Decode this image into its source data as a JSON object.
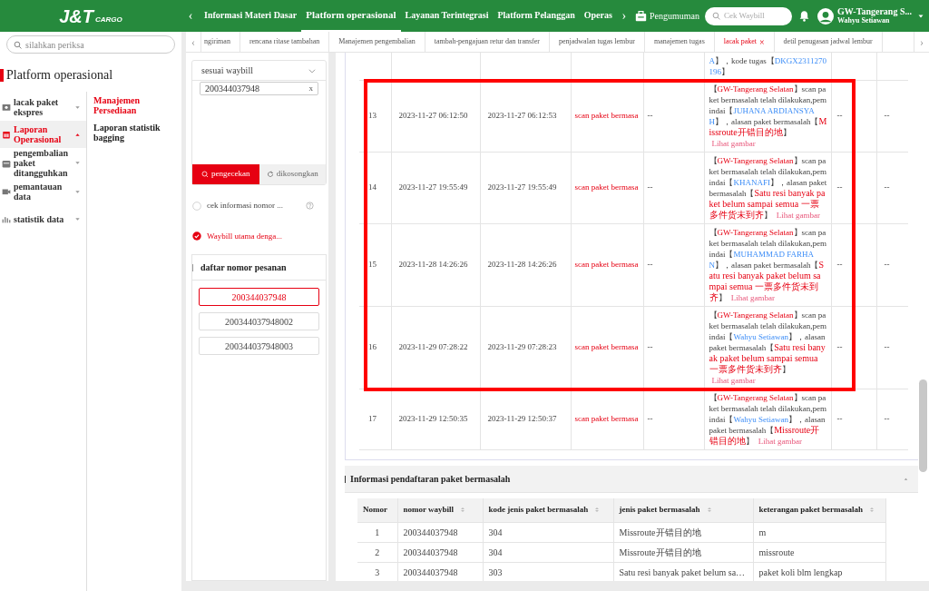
{
  "header": {
    "logo": {
      "main": "J&T",
      "sub": "CARGO"
    },
    "prev": "‹",
    "next": "›",
    "nav": [
      {
        "label": "Informasi Materi Dasar",
        "selected": false
      },
      {
        "label": "Platform operasional",
        "selected": true
      },
      {
        "label": "Layanan Terintegrasi",
        "selected": false
      },
      {
        "label": "Platform Pelanggan",
        "selected": false
      },
      {
        "label": "Operas",
        "selected": false
      }
    ],
    "announcement": "Pengumuman",
    "search": {
      "placeholder": "Cek Waybill"
    },
    "user": {
      "name": "GW-Tangerang S...",
      "role": "Wahyu Setiawan"
    }
  },
  "sidebar": {
    "search": {
      "placeholder": "silahkan periksa"
    },
    "title": "Platform operasional",
    "menu": [
      {
        "label": "lacak paket ekspres",
        "selected": false,
        "expanded": false
      },
      {
        "label": "Laporan Operasional",
        "selected": true,
        "expanded": true
      },
      {
        "label": "pengembalian paket ditangguhkan",
        "selected": false,
        "expanded": false
      },
      {
        "label": "pemantauan data",
        "selected": false,
        "expanded": false
      },
      {
        "label": "statistik data",
        "selected": false,
        "expanded": false
      }
    ],
    "submenu": [
      {
        "label": "Manajemen Persediaan",
        "selected": true
      },
      {
        "label": "Laporan statistik bagging",
        "selected": false
      }
    ]
  },
  "tabs": {
    "prev": "‹",
    "next": "›",
    "items": [
      {
        "label": "ngiriman",
        "selected": false,
        "closable": false
      },
      {
        "label": "rencana ritase tambahan",
        "selected": false,
        "closable": false
      },
      {
        "label": "Manajemen pengembalian",
        "selected": false,
        "closable": false
      },
      {
        "label": "tambah-pengajuan retur dan transfer",
        "selected": false,
        "closable": false
      },
      {
        "label": "penjadwalan tugas lembur",
        "selected": false,
        "closable": false
      },
      {
        "label": "manajemen tugas",
        "selected": false,
        "closable": false
      },
      {
        "label": "lacak paket",
        "selected": true,
        "closable": true,
        "close": "×"
      },
      {
        "label": "detil penugasan jadwal lembur",
        "selected": false,
        "closable": false
      }
    ]
  },
  "query": {
    "mode": "sesuai waybill",
    "tags": [
      {
        "text": "200344037948",
        "remove": "x"
      }
    ],
    "buttons": [
      {
        "label": "pengecekan",
        "kind": "primary"
      },
      {
        "label": "dikosongkan",
        "kind": "reset"
      }
    ],
    "options": [
      {
        "label": "cek informasi nomor ...",
        "selected": false,
        "help": true
      },
      {
        "label": "Waybill utama denga...",
        "selected": true,
        "help": false
      }
    ],
    "list_title": "daftar nomor pesanan",
    "orders": [
      {
        "text": "200344037948",
        "selected": true
      },
      {
        "text": "200344037948002",
        "selected": false
      },
      {
        "text": "200344037948003",
        "selected": false
      }
    ]
  },
  "tracking": {
    "rows": [
      {
        "kind": "partial",
        "highlighted": false,
        "desc": [
          {
            "kind": "person",
            "text": "A"
          },
          {
            "kind": "plain",
            "text": "】，kode tugas【"
          },
          {
            "kind": "person",
            "text": "DKGX2311270196"
          },
          {
            "kind": "plain",
            "text": "】"
          }
        ]
      },
      {
        "kind": "full",
        "highlighted": true,
        "no": "13",
        "time_1": "2023-11-27 06:12:50",
        "time_2": "2023-11-27 06:12:53",
        "type": "scan paket bermasa",
        "column_5": "--",
        "desc": [
          {
            "kind": "plain",
            "text": "【"
          },
          {
            "kind": "place",
            "text": "GW-Tangerang Selatan"
          },
          {
            "kind": "plain",
            "text": "】scan paket bermasalah telah dilakukan,pemindai【"
          },
          {
            "kind": "person",
            "text": "JUHANA ARDIANSYAH"
          },
          {
            "kind": "plain",
            "text": "】，alasan paket bermasalah【"
          },
          {
            "kind": "reason",
            "text": "Missroute开错目的地"
          },
          {
            "kind": "plain",
            "text": "】"
          }
        ],
        "link": "Lihat gambar",
        "column_7": "--",
        "column_8": "--"
      },
      {
        "kind": "full",
        "highlighted": true,
        "no": "14",
        "time_1": "2023-11-27 19:55:49",
        "time_2": "2023-11-27 19:55:49",
        "type": "scan paket bermasa",
        "column_5": "--",
        "desc": [
          {
            "kind": "plain",
            "text": "【"
          },
          {
            "kind": "place",
            "text": "GW-Tangerang Selatan"
          },
          {
            "kind": "plain",
            "text": "】scan paket bermasalah telah dilakukan,pemindai【"
          },
          {
            "kind": "person",
            "text": "KHANAFI"
          },
          {
            "kind": "plain",
            "text": "】，alasan paket bermasalah【"
          },
          {
            "kind": "reason",
            "text": "Satu resi banyak paket belum sampai semua 一票多件货未到齐"
          },
          {
            "kind": "plain",
            "text": "】"
          }
        ],
        "link": "Lihat gambar",
        "column_7": "--",
        "column_8": "--"
      },
      {
        "kind": "full",
        "highlighted": true,
        "no": "15",
        "time_1": "2023-11-28 14:26:26",
        "time_2": "2023-11-28 14:26:26",
        "type": "scan paket bermasa",
        "column_5": "--",
        "desc": [
          {
            "kind": "plain",
            "text": "【"
          },
          {
            "kind": "place",
            "text": "GW-Tangerang Selatan"
          },
          {
            "kind": "plain",
            "text": "】scan paket bermasalah telah dilakukan,pemindai【"
          },
          {
            "kind": "person",
            "text": "MUHAMMAD FARHAN"
          },
          {
            "kind": "plain",
            "text": "】，alasan paket bermasalah【"
          },
          {
            "kind": "reason",
            "text": "Satu resi banyak paket belum sampai semua 一票多件货未到齐"
          },
          {
            "kind": "plain",
            "text": "】"
          }
        ],
        "link": "Lihat gambar",
        "column_7": "--",
        "column_8": "--"
      },
      {
        "kind": "full",
        "highlighted": true,
        "no": "16",
        "time_1": "2023-11-29 07:28:22",
        "time_2": "2023-11-29 07:28:23",
        "type": "scan paket bermasa",
        "column_5": "--",
        "desc": [
          {
            "kind": "plain",
            "text": "【"
          },
          {
            "kind": "place",
            "text": "GW-Tangerang Selatan"
          },
          {
            "kind": "plain",
            "text": "】scan paket bermasalah telah dilakukan,pemindai【"
          },
          {
            "kind": "person",
            "text": "Wahyu Setiawan"
          },
          {
            "kind": "plain",
            "text": "】，alasan paket bermasalah【"
          },
          {
            "kind": "reason",
            "text": "Satu resi banyak paket belum sampai semua 一票多件货未到齐"
          },
          {
            "kind": "plain",
            "text": "】"
          }
        ],
        "link": "Lihat gambar",
        "column_7": "--",
        "column_8": "--"
      },
      {
        "kind": "full",
        "highlighted": false,
        "no": "17",
        "time_1": "2023-11-29 12:50:35",
        "time_2": "2023-11-29 12:50:37",
        "type": "scan paket bermasa",
        "column_5": "--",
        "desc": [
          {
            "kind": "plain",
            "text": "【"
          },
          {
            "kind": "place",
            "text": "GW-Tangerang Selatan"
          },
          {
            "kind": "plain",
            "text": "】scan paket bermasalah telah dilakukan,pemindai【"
          },
          {
            "kind": "person",
            "text": "Wahyu Setiawan"
          },
          {
            "kind": "plain",
            "text": "】，alasan paket bermasalah【"
          },
          {
            "kind": "reason",
            "text": "Missroute开错目的地"
          },
          {
            "kind": "plain",
            "text": "】"
          }
        ],
        "link": "Lihat gambar",
        "column_7": "--",
        "column_8": "--"
      }
    ]
  },
  "problem_section": {
    "title": "Informasi pendaftaran paket bermasalah",
    "expanded": true,
    "columns": [
      {
        "label": "Nomor",
        "sortable": false
      },
      {
        "label": "nomor waybill",
        "sortable": true
      },
      {
        "label": "kode jenis paket bermasalah",
        "sortable": true
      },
      {
        "label": "jenis paket bermasalah",
        "sortable": true
      },
      {
        "label": "keterangan paket bermasalah",
        "sortable": true
      }
    ],
    "rows": [
      [
        "1",
        "200344037948",
        "304",
        "Missroute开错目的地",
        "m"
      ],
      [
        "2",
        "200344037948",
        "304",
        "Missroute开错目的地",
        "missroute"
      ],
      [
        "3",
        "200344037948",
        "303",
        "Satu resi banyak paket belum sa…",
        "paket koli blm lengkap"
      ]
    ]
  }
}
